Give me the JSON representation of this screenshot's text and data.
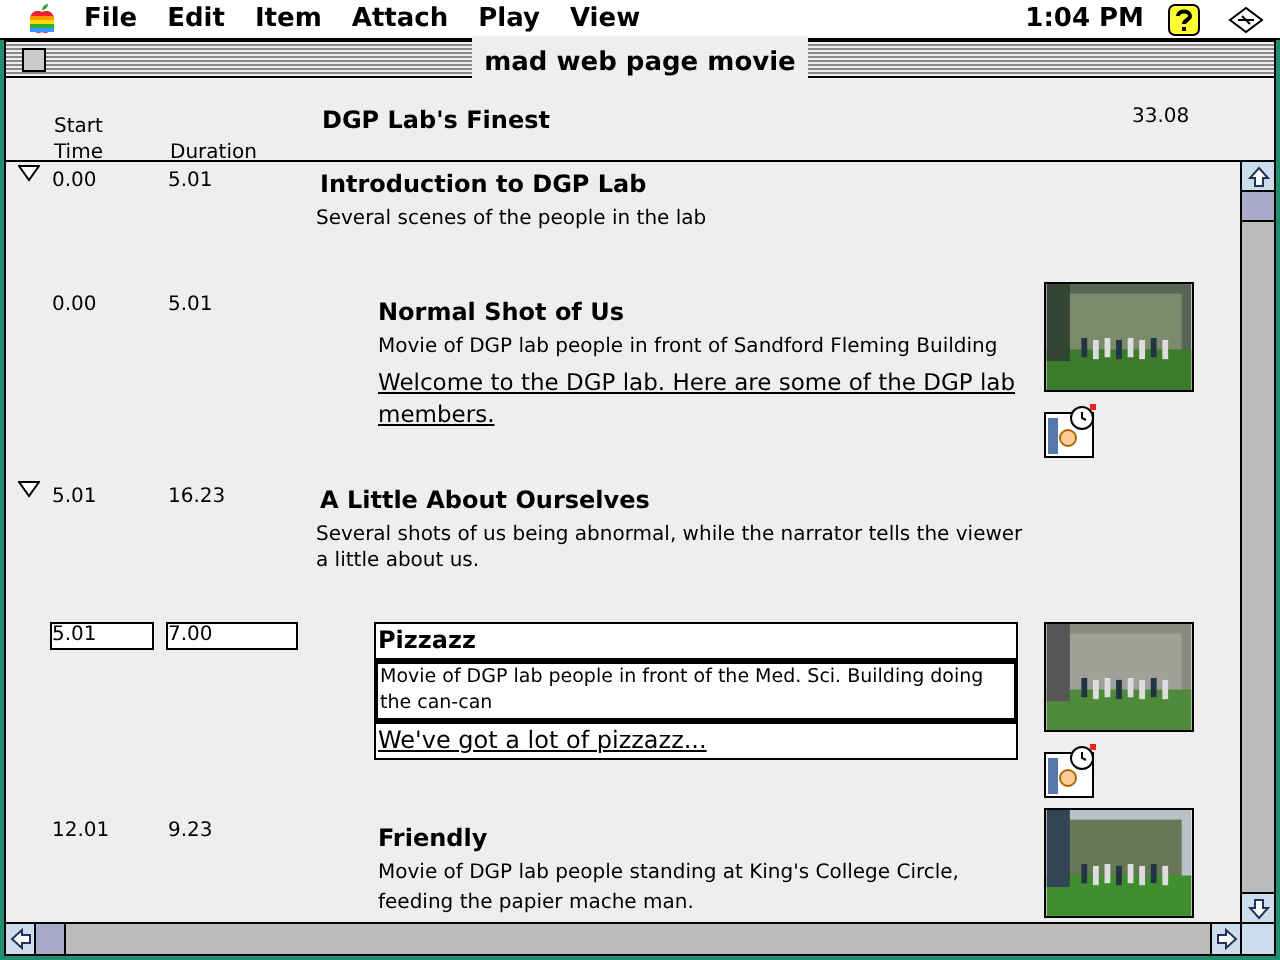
{
  "menu_bar": {
    "items": [
      "File",
      "Edit",
      "Item",
      "Attach",
      "Play",
      "View"
    ],
    "clock": "1:04 PM"
  },
  "window": {
    "title": "mad web page movie"
  },
  "header": {
    "start_label": "Start Time",
    "duration_label": "Duration",
    "movie_title": "DGP Lab's Finest",
    "total": "33.08"
  },
  "rows": [
    {
      "kind": "section",
      "expanded": true,
      "start": "0.00",
      "duration": "5.01",
      "title": "Introduction to DGP Lab",
      "description": "Several scenes of the people in the lab"
    },
    {
      "kind": "clip",
      "editing": false,
      "start": "0.00",
      "duration": "5.01",
      "title": "Normal Shot of Us",
      "description": "Movie of DGP lab people in front of Sandford Fleming Building",
      "caption": "Welcome to the DGP lab.  Here are some of the DGP lab members."
    },
    {
      "kind": "section",
      "expanded": true,
      "start": "5.01",
      "duration": "16.23",
      "title": "A Little About Ourselves",
      "description": "Several shots of us being abnormal, while the narrator tells the viewer a little about us."
    },
    {
      "kind": "clip",
      "editing": true,
      "start": "5.01",
      "duration": "7.00",
      "title": "Pizzazz",
      "description": "Movie of DGP lab people in front of the Med. Sci. Building doing the can-can",
      "caption": "We've got a lot of pizzazz..."
    },
    {
      "kind": "clip",
      "editing": false,
      "start": "12.01",
      "duration": "9.23",
      "title": "Friendly",
      "description": "Movie of DGP lab people standing at King's College Circle, feeding the papier mache man."
    }
  ]
}
